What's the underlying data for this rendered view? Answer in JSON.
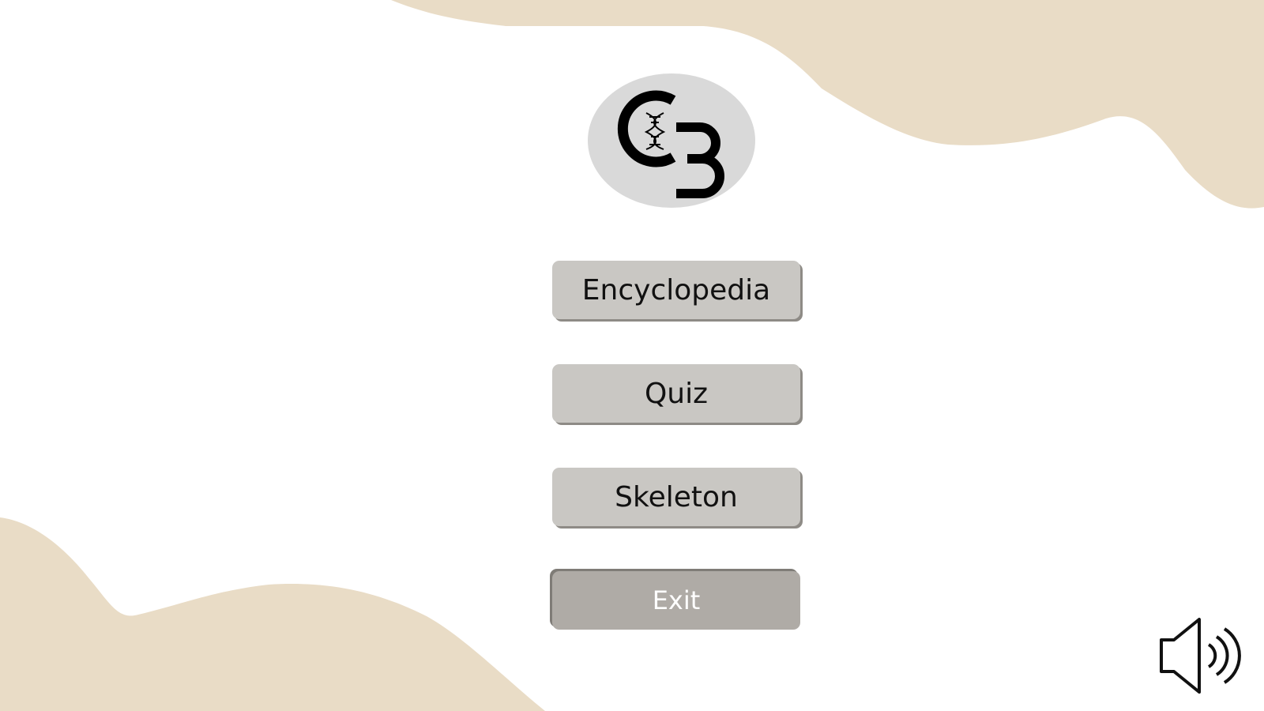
{
  "logo": {
    "letters": "C3",
    "icon": "dna-icon"
  },
  "menu": {
    "encyclopedia_label": "Encyclopedia",
    "quiz_label": "Quiz",
    "skeleton_label": "Skeleton",
    "exit_label": "Exit"
  },
  "sound": {
    "icon": "speaker-volume-icon"
  },
  "colors": {
    "background": "#ffffff",
    "blob": "#e9dcc6",
    "button": "#c9c7c3",
    "exit_button": "#afaba6",
    "logo_circle": "#d9d9d9"
  }
}
